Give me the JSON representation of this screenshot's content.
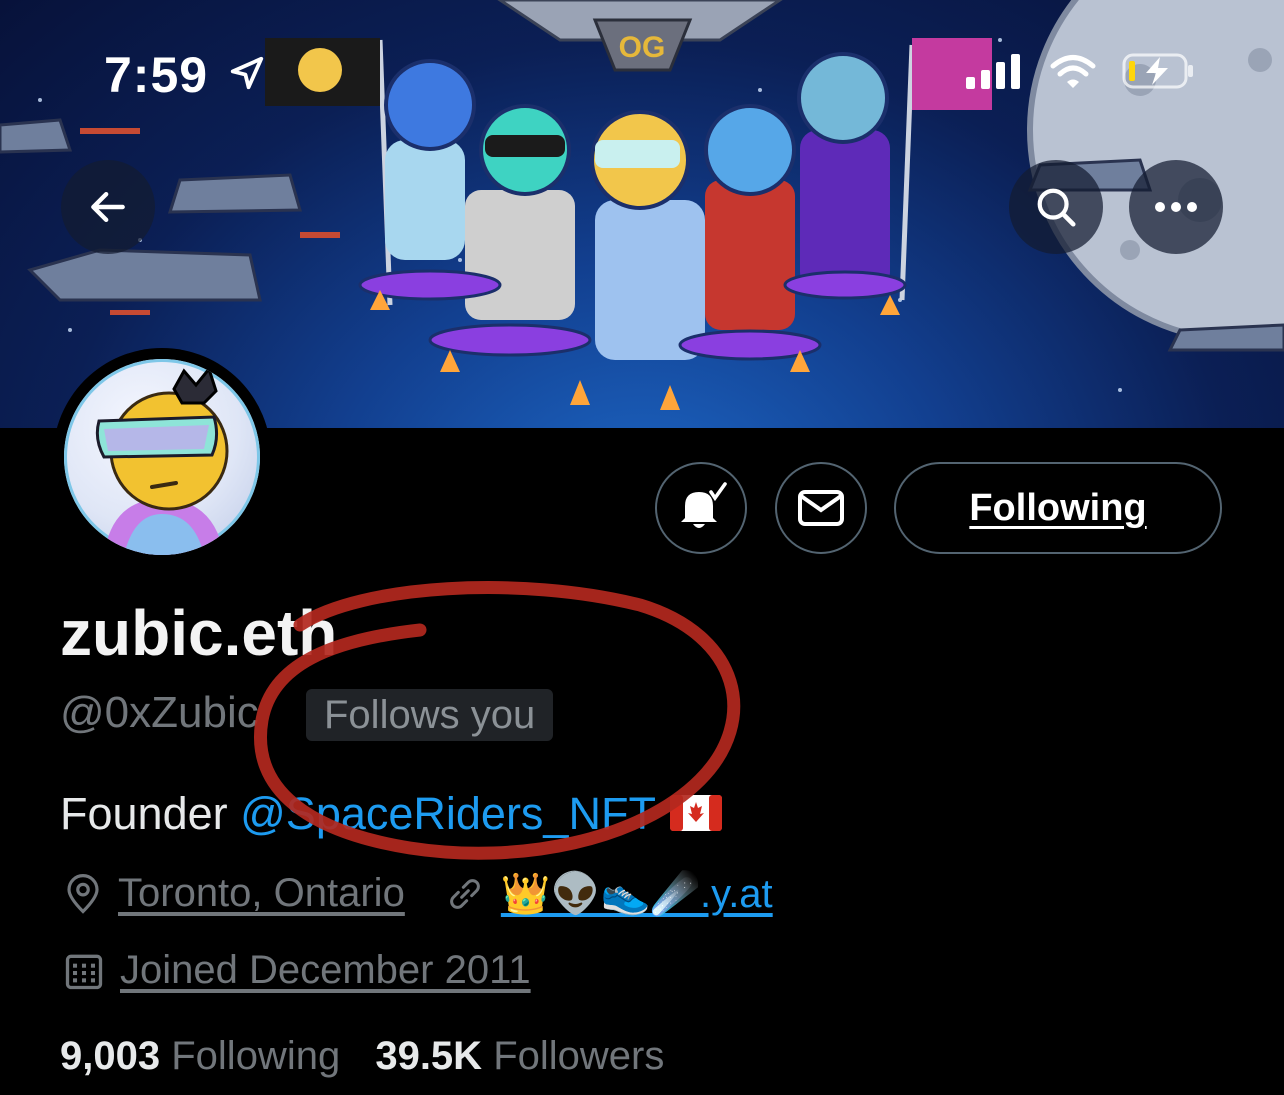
{
  "status_bar": {
    "time": "7:59"
  },
  "banner": {
    "badge_text": "OG"
  },
  "header": {
    "back_icon": "arrow-left-icon",
    "search_icon": "search-icon",
    "more_icon": "more-horizontal-icon"
  },
  "actions": {
    "notifications_icon": "bell-check-icon",
    "message_icon": "envelope-icon",
    "following_label": "Following"
  },
  "profile": {
    "display_name": "zubic.eth",
    "handle": "@0xZubic",
    "follows_you": "Follows you",
    "bio_prefix": "Founder ",
    "bio_mention": "@SpaceRiders_NFT",
    "location": "Toronto, Ontario",
    "website": "👑👽👟☄️.y.at",
    "joined": "Joined December 2011"
  },
  "stats": {
    "following_count": "9,003",
    "following_label": "Following",
    "followers_count": "39.5K",
    "followers_label": "Followers"
  },
  "colors": {
    "accent": "#1d9bf0",
    "muted": "#71767b",
    "annotation": "#b3281e"
  }
}
